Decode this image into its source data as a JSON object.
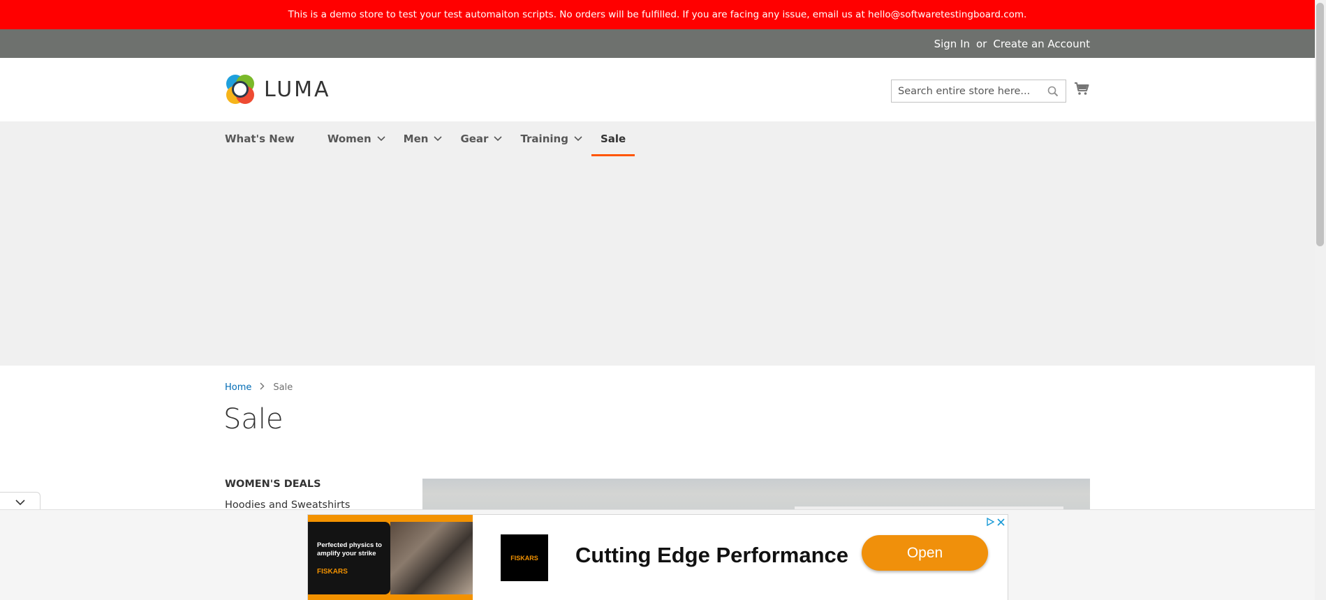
{
  "demo_banner": {
    "text": "This is a demo store to test your test automaiton scripts. No orders will be fulfilled. If you are facing any issue, email us at hello@softwaretestingboard.com."
  },
  "top_links": {
    "sign_in": "Sign In",
    "separator": "or",
    "create_account": "Create an Account"
  },
  "header": {
    "logo_text": "LUMA",
    "search_placeholder": "Search entire store here...",
    "search_icon": "search-icon",
    "cart_icon": "shopping-cart-icon"
  },
  "nav": {
    "items": [
      {
        "label": "What's New",
        "has_dropdown": false
      },
      {
        "label": "Women",
        "has_dropdown": true
      },
      {
        "label": "Men",
        "has_dropdown": true
      },
      {
        "label": "Gear",
        "has_dropdown": true
      },
      {
        "label": "Training",
        "has_dropdown": true
      },
      {
        "label": "Sale",
        "has_dropdown": false,
        "active": true
      }
    ],
    "active_color": "#ff5501"
  },
  "breadcrumb": {
    "home": "Home",
    "current": "Sale"
  },
  "page": {
    "title": "Sale"
  },
  "sidebar": {
    "heading": "WOMEN'S DEALS",
    "items": [
      "Hoodies and Sweatshirts"
    ]
  },
  "ad": {
    "image_tagline": "Perfected physics to amplify your strike",
    "image_brand": "FISKARS",
    "logo_brand": "FISKARS",
    "headline": "Cutting Edge Performance",
    "cta": "Open",
    "cta_color": "#f0900b",
    "choices_icons": [
      "adchoices-icon",
      "close-icon"
    ],
    "toggle_icon": "chevron-down-icon"
  },
  "colors": {
    "banner": "#ff0000",
    "top_bar": "#6e716e",
    "link": "#006bb4",
    "nav_bg": "#f0f0f0"
  }
}
